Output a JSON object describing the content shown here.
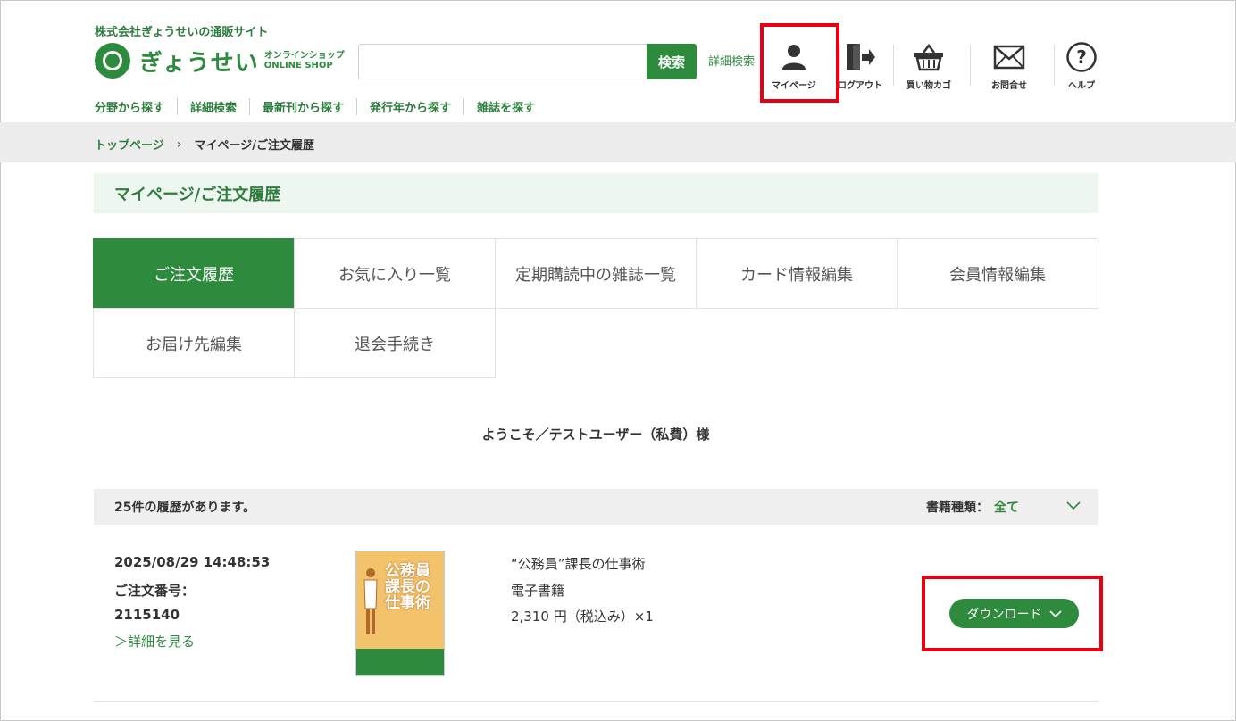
{
  "header": {
    "company": "株式会社ぎょうせいの通販サイト",
    "logo_main": "ぎょうせい",
    "logo_sub_jp": "オンラインショップ",
    "logo_sub_en": "ONLINE SHOP",
    "search_placeholder": "",
    "search_button": "検索",
    "advanced_search": "詳細検索",
    "icons": {
      "mypage": "マイページ",
      "logout": "ログアウト",
      "cart": "買い物カゴ",
      "contact": "お問合せ",
      "help": "ヘルプ"
    }
  },
  "subnav": [
    "分野から探す",
    "詳細検索",
    "最新刊から探す",
    "発行年から探す",
    "雑誌を探す"
  ],
  "breadcrumb": {
    "home": "トップページ",
    "current": "マイページ/ご注文履歴"
  },
  "page_title": "マイページ/ご注文履歴",
  "tabs": [
    "ご注文履歴",
    "お気に入り一覧",
    "定期購読中の雑誌一覧",
    "カード情報編集",
    "会員情報編集",
    "お届け先編集",
    "退会手続き"
  ],
  "welcome": "ようこそ／テストユーザー（私費）様",
  "history": {
    "count_text": "25件の履歴があります。",
    "filter_label": "書籍種類：",
    "filter_value": "全て"
  },
  "order": {
    "date": "2025/08/29 14:48:53",
    "number_label": "ご注文番号：",
    "number": "2115140",
    "detail_link": "＞詳細を見る",
    "book_cover_title": "公務員 課長の 仕事術",
    "item_title": "“公務員”課長の仕事術",
    "item_type": "電子書籍",
    "item_price": "2,310 円（税込み）×1",
    "download_button": "ダウンロード"
  },
  "colors": {
    "brand": "#2e8b3e",
    "highlight": "#e60012"
  }
}
